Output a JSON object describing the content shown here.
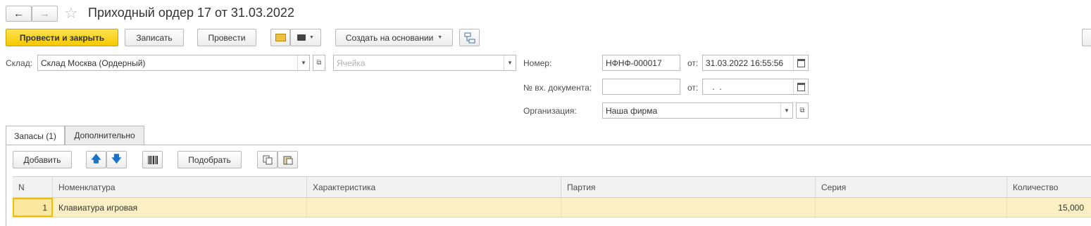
{
  "header": {
    "title": "Приходный ордер 17 от 31.03.2022",
    "back_icon": "arrow-left-icon",
    "forward_icon": "arrow-right-icon",
    "favorite_icon": "star-icon"
  },
  "toolbar": {
    "post_close_label": "Провести и закрыть",
    "save_label": "Записать",
    "post_label": "Провести",
    "create_based_label": "Создать на основании"
  },
  "form": {
    "warehouse_label": "Склад:",
    "warehouse_value": "Склад Москва (Ордерный)",
    "cell_placeholder": "Ячейка",
    "number_label": "Номер:",
    "number_value": "НФНФ-000017",
    "date_label": "от:",
    "date_value": "31.03.2022 16:55:56",
    "incoming_doc_label": "№ вх. документа:",
    "incoming_doc_value": "",
    "incoming_date_label": "от:",
    "incoming_date_value": " .  .",
    "org_label": "Организация:",
    "org_value": "Наша фирма"
  },
  "tabs": [
    {
      "label": "Запасы (1)",
      "active": true
    },
    {
      "label": "Дополнительно",
      "active": false
    }
  ],
  "table_toolbar": {
    "add_label": "Добавить",
    "pick_label": "Подобрать"
  },
  "table": {
    "columns": [
      "N",
      "Номенклатура",
      "Характеристика",
      "Партия",
      "Серия",
      "Количество"
    ],
    "rows": [
      {
        "n": "1",
        "item": "Клавиатура игровая",
        "characteristic": "",
        "batch": "",
        "series": "",
        "qty": "15,000"
      }
    ]
  },
  "colors": {
    "primary_button": "#f5c800",
    "selected_row": "#fbf0c4"
  }
}
